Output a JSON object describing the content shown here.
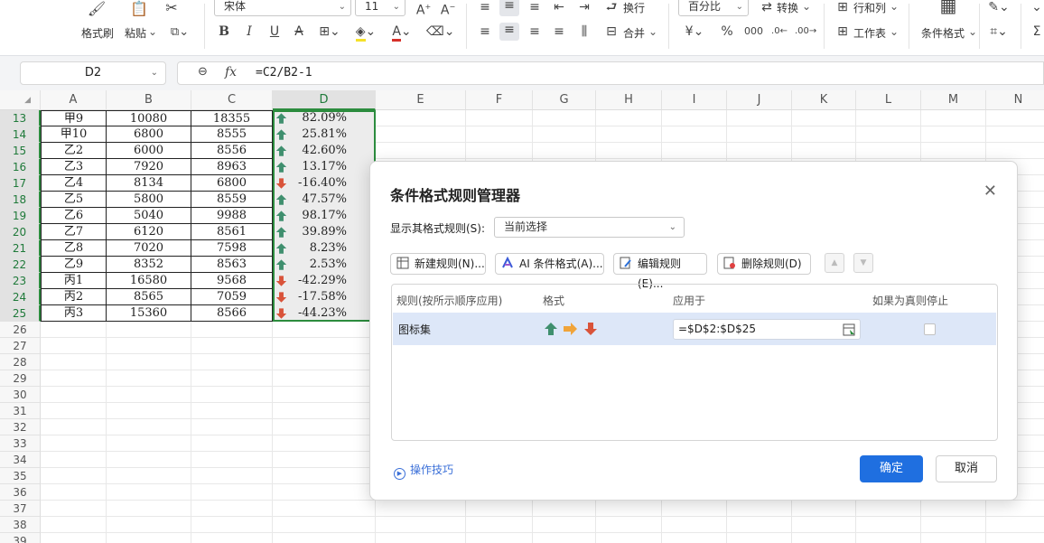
{
  "ribbon": {
    "format_painter": "格式刷",
    "paste": "粘贴",
    "font_name": "宋体",
    "font_size": "11",
    "wrap_text": "换行",
    "merge": "合并",
    "number_format": "百分比",
    "convert": "转换",
    "rows_cols": "行和列",
    "worksheet": "工作表",
    "conditional_format": "条件格式"
  },
  "formula_bar": {
    "name_box": "D2",
    "fx": "fx",
    "formula": "=C2/B2-1"
  },
  "columns": [
    "A",
    "B",
    "C",
    "D",
    "E",
    "F",
    "G",
    "H",
    "I",
    "J",
    "K",
    "L",
    "M",
    "N"
  ],
  "rows": [
    {
      "num": "13",
      "a": "甲9",
      "b": "10080",
      "c": "18355",
      "d": "82.09%",
      "icon": "up"
    },
    {
      "num": "14",
      "a": "甲10",
      "b": "6800",
      "c": "8555",
      "d": "25.81%",
      "icon": "up"
    },
    {
      "num": "15",
      "a": "乙2",
      "b": "6000",
      "c": "8556",
      "d": "42.60%",
      "icon": "up"
    },
    {
      "num": "16",
      "a": "乙3",
      "b": "7920",
      "c": "8963",
      "d": "13.17%",
      "icon": "up"
    },
    {
      "num": "17",
      "a": "乙4",
      "b": "8134",
      "c": "6800",
      "d": "-16.40%",
      "icon": "down"
    },
    {
      "num": "18",
      "a": "乙5",
      "b": "5800",
      "c": "8559",
      "d": "47.57%",
      "icon": "up"
    },
    {
      "num": "19",
      "a": "乙6",
      "b": "5040",
      "c": "9988",
      "d": "98.17%",
      "icon": "up"
    },
    {
      "num": "20",
      "a": "乙7",
      "b": "6120",
      "c": "8561",
      "d": "39.89%",
      "icon": "up"
    },
    {
      "num": "21",
      "a": "乙8",
      "b": "7020",
      "c": "7598",
      "d": "8.23%",
      "icon": "up"
    },
    {
      "num": "22",
      "a": "乙9",
      "b": "8352",
      "c": "8563",
      "d": "2.53%",
      "icon": "up"
    },
    {
      "num": "23",
      "a": "丙1",
      "b": "16580",
      "c": "9568",
      "d": "-42.29%",
      "icon": "down"
    },
    {
      "num": "24",
      "a": "丙2",
      "b": "8565",
      "c": "7059",
      "d": "-17.58%",
      "icon": "down"
    },
    {
      "num": "25",
      "a": "丙3",
      "b": "15360",
      "c": "8566",
      "d": "-44.23%",
      "icon": "down"
    }
  ],
  "empty_rows": [
    "26",
    "27",
    "28",
    "29",
    "30",
    "31",
    "32",
    "33",
    "34",
    "35",
    "36",
    "37",
    "38",
    "39"
  ],
  "icon_colors": {
    "up": "#3f8f6e",
    "right": "#f0a43a",
    "down": "#d9533a"
  },
  "dialog": {
    "title": "条件格式规则管理器",
    "show_rules_label": "显示其格式规则(S):",
    "show_rules_value": "当前选择",
    "new_rule": "新建规则(N)...",
    "ai_format": "AI 条件格式(A)...",
    "edit_rule": "编辑规则(E)...",
    "delete_rule": "删除规则(D)",
    "col_rule": "规则(按所示顺序应用)",
    "col_format": "格式",
    "col_applies": "应用于",
    "col_stop": "如果为真则停止",
    "rule_name": "图标集",
    "applies_to": "=$D$2:$D$25",
    "tips": "操作技巧",
    "ok": "确定",
    "cancel": "取消"
  }
}
